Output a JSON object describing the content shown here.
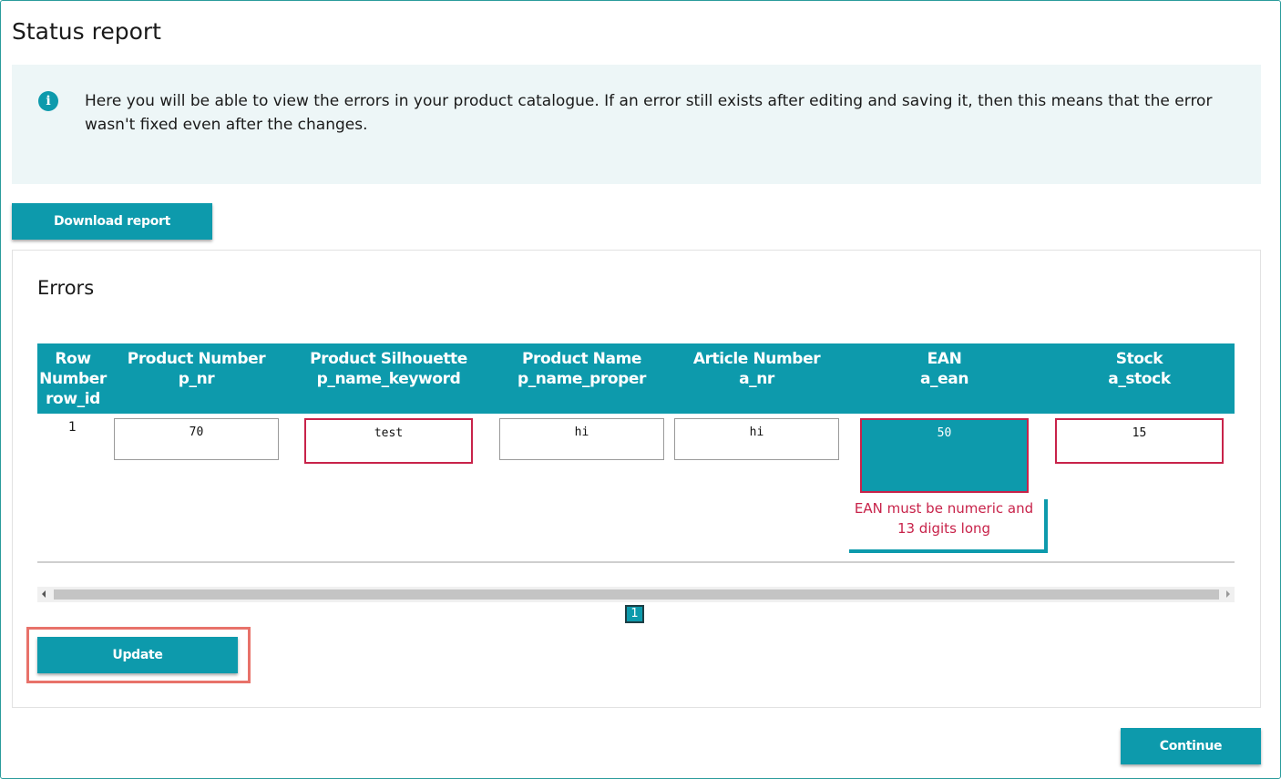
{
  "page": {
    "title": "Status report",
    "info_text": "Here you will be able to view the errors in your product catalogue. If an error still exists after editing and saving it, then this means that the error wasn't fixed even after the changes.",
    "info_icon": "info-icon",
    "download_label": "Download report",
    "update_label": "Update",
    "continue_label": "Continue"
  },
  "errors": {
    "title": "Errors",
    "columns": [
      {
        "label": "Row Number",
        "key": "row_id"
      },
      {
        "label": "Product Number",
        "key": "p_nr"
      },
      {
        "label": "Product Silhouette",
        "key": "p_name_keyword"
      },
      {
        "label": "Product Name",
        "key": "p_name_proper"
      },
      {
        "label": "Article Number",
        "key": "a_nr"
      },
      {
        "label": "EAN",
        "key": "a_ean"
      },
      {
        "label": "Stock",
        "key": "a_stock"
      }
    ],
    "row": {
      "row_id": "1",
      "p_nr": "70",
      "p_name_keyword": "test",
      "p_name_proper": "hi",
      "a_nr": "hi",
      "a_ean": "50",
      "a_stock": "15"
    },
    "ean_error": "EAN must be numeric and 13 digits long",
    "pagination": {
      "current": "1"
    }
  },
  "colors": {
    "accent": "#0d9aac",
    "error": "#c8234a",
    "info_bg": "#edf6f7",
    "highlight": "#e8726a"
  }
}
